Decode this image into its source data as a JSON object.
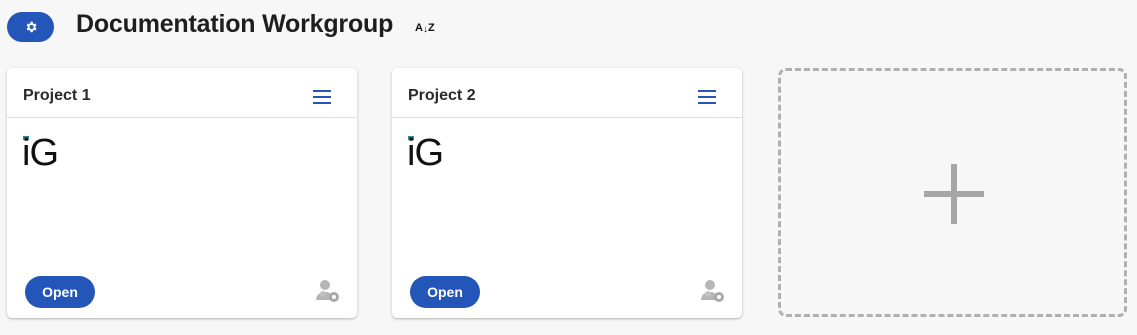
{
  "header": {
    "title": "Documentation Workgroup",
    "settings_icon": "gear-icon",
    "sort": {
      "from": "A",
      "to": "Z",
      "icon": "sort-alpha-icon"
    }
  },
  "projects": [
    {
      "name": "Project 1",
      "logo_text": "iG",
      "open_label": "Open",
      "menu_icon": "hamburger-menu-icon",
      "members_icon": "user-settings-icon"
    },
    {
      "name": "Project 2",
      "logo_text": "iG",
      "open_label": "Open",
      "menu_icon": "hamburger-menu-icon",
      "members_icon": "user-settings-icon"
    }
  ],
  "add_project": {
    "icon": "plus-icon"
  },
  "colors": {
    "accent": "#2356b8",
    "background": "#f7f7f7",
    "dashed_border": "#b0b0b0",
    "logo_accent": "#2a86a8"
  }
}
